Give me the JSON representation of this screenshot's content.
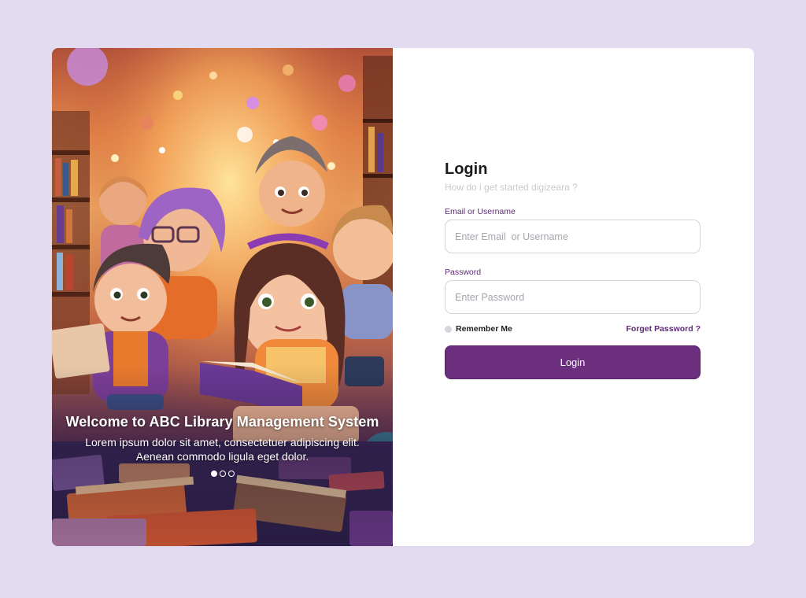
{
  "colors": {
    "page_background": "#e3dbef",
    "accent": "#6b2f7e",
    "label": "#5e2a76"
  },
  "hero": {
    "image": "illustration of children reading books in a library",
    "title": "Welcome to ABC Library Management System",
    "description_line1": "Lorem ipsum dolor sit amet, consectetuer adipiscing elit.",
    "description_line2": "Aenean commodo ligula eget dolor.",
    "carousel": {
      "slide_count": 3,
      "active_index": 0
    }
  },
  "login": {
    "title": "Login",
    "subtitle": "How do i get started digizeara ?",
    "email": {
      "label": "Email or Username",
      "placeholder": "Enter Email  or Username",
      "value": ""
    },
    "password": {
      "label": "Password",
      "placeholder": "Enter Password",
      "value": ""
    },
    "remember_me": {
      "label": "Remember Me",
      "checked": false
    },
    "forgot_password": "Forget Password ?",
    "submit_label": "Login"
  }
}
